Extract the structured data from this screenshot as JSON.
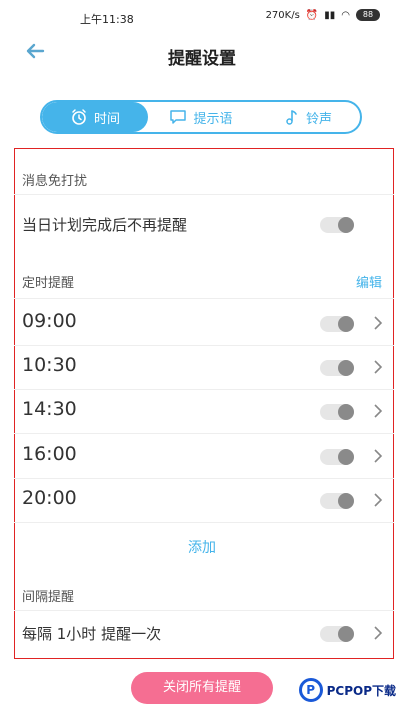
{
  "statusbar": {
    "time": "上午11:38",
    "network": "270K/s",
    "battery": "88"
  },
  "header": {
    "title": "提醒设置",
    "back_icon": "arrow-left-icon"
  },
  "tabs": [
    {
      "label": "时间",
      "icon": "alarm-clock-icon",
      "active": true
    },
    {
      "label": "提示语",
      "icon": "message-icon",
      "active": false
    },
    {
      "label": "铃声",
      "icon": "music-note-icon",
      "active": false
    }
  ],
  "dnd": {
    "heading": "消息免打扰",
    "option": "当日计划完成后不再提醒",
    "enabled": false
  },
  "scheduled": {
    "heading": "定时提醒",
    "edit_label": "编辑",
    "times": [
      {
        "time": "09:00",
        "enabled": false
      },
      {
        "time": "10:30",
        "enabled": false
      },
      {
        "time": "14:30",
        "enabled": false
      },
      {
        "time": "16:00",
        "enabled": false
      },
      {
        "time": "20:00",
        "enabled": false
      }
    ],
    "add_label": "添加"
  },
  "interval": {
    "heading": "间隔提醒",
    "option": "每隔 1小时 提醒一次",
    "enabled": false
  },
  "footer": {
    "close_all_label": "关闭所有提醒",
    "brand": "PCPOP下载"
  },
  "colors": {
    "accent": "#45b4ea",
    "pink": "#f56e92",
    "frame": "#e02323"
  }
}
